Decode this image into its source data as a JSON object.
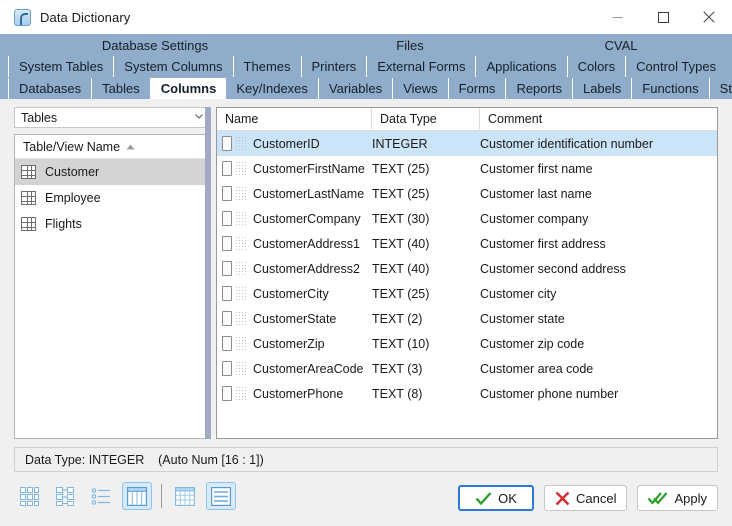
{
  "window": {
    "title": "Data Dictionary",
    "app_icon": "app-icon",
    "controls": {
      "minimize": "─",
      "maximize": "□",
      "close": "✕"
    }
  },
  "tab_groups": [
    {
      "label": "Database Settings"
    },
    {
      "label": "Files"
    },
    {
      "label": "CVAL"
    }
  ],
  "tabs_row1": [
    {
      "label": "System Tables",
      "selected": false
    },
    {
      "label": "System Columns",
      "selected": false
    },
    {
      "label": "Themes",
      "selected": false
    },
    {
      "label": "Printers",
      "selected": false
    },
    {
      "label": "External Forms",
      "selected": false
    },
    {
      "label": "Applications",
      "selected": false
    },
    {
      "label": "Colors",
      "selected": false
    },
    {
      "label": "Control Types",
      "selected": false
    }
  ],
  "tabs_row2": [
    {
      "label": "Databases",
      "selected": false
    },
    {
      "label": "Tables",
      "selected": false
    },
    {
      "label": "Columns",
      "selected": true
    },
    {
      "label": "Key/Indexes",
      "selected": false
    },
    {
      "label": "Variables",
      "selected": false
    },
    {
      "label": "Views",
      "selected": false
    },
    {
      "label": "Forms",
      "selected": false
    },
    {
      "label": "Reports",
      "selected": false
    },
    {
      "label": "Labels",
      "selected": false
    },
    {
      "label": "Functions",
      "selected": false
    },
    {
      "label": "Stored Procedures",
      "selected": false
    }
  ],
  "left_panel": {
    "combo": {
      "value": "Tables",
      "options": [
        "Tables"
      ]
    },
    "list_header": "Table/View Name",
    "sort_direction": "ascending",
    "items": [
      {
        "label": "Customer",
        "selected": true
      },
      {
        "label": "Employee",
        "selected": false
      },
      {
        "label": "Flights",
        "selected": false
      }
    ]
  },
  "grid": {
    "columns": [
      "Name",
      "Data Type",
      "Comment"
    ],
    "rows": [
      {
        "name": "CustomerID",
        "type": "INTEGER",
        "comment": "Customer identification number",
        "selected": true
      },
      {
        "name": "CustomerFirstName",
        "type": "TEXT (25)",
        "comment": "Customer first name",
        "selected": false
      },
      {
        "name": "CustomerLastName",
        "type": "TEXT (25)",
        "comment": "Customer last name",
        "selected": false
      },
      {
        "name": "CustomerCompany",
        "type": "TEXT (30)",
        "comment": "Customer company",
        "selected": false
      },
      {
        "name": "CustomerAddress1",
        "type": "TEXT (40)",
        "comment": "Customer first address",
        "selected": false
      },
      {
        "name": "CustomerAddress2",
        "type": "TEXT (40)",
        "comment": "Customer second address",
        "selected": false
      },
      {
        "name": "CustomerCity",
        "type": "TEXT (25)",
        "comment": "Customer city",
        "selected": false
      },
      {
        "name": "CustomerState",
        "type": "TEXT (2)",
        "comment": "Customer state",
        "selected": false
      },
      {
        "name": "CustomerZip",
        "type": "TEXT (10)",
        "comment": "Customer zip code",
        "selected": false
      },
      {
        "name": "CustomerAreaCode",
        "type": "TEXT (3)",
        "comment": "Customer area code",
        "selected": false
      },
      {
        "name": "CustomerPhone",
        "type": "TEXT (8)",
        "comment": "Customer phone number",
        "selected": false
      }
    ]
  },
  "status_bar": {
    "text": "Data Type: INTEGER    (Auto Num [16 : 1])"
  },
  "view_buttons": [
    {
      "name": "large-icons-view",
      "active": false
    },
    {
      "name": "tree-view",
      "active": false
    },
    {
      "name": "list-view",
      "active": false
    },
    {
      "name": "column-view",
      "active": true
    },
    {
      "name": "grid-view",
      "active": false
    },
    {
      "name": "detail-view",
      "active": true
    }
  ],
  "dialog_buttons": [
    {
      "label": "OK",
      "icon": "check-icon",
      "default": true
    },
    {
      "label": "Cancel",
      "icon": "cross-icon",
      "default": false
    },
    {
      "label": "Apply",
      "icon": "double-check-icon",
      "default": false
    }
  ],
  "colors": {
    "tab_band": "#8facca",
    "selection_row": "#cce4f7",
    "list_selection": "#d4d4d4",
    "splitter": "#9fabc4",
    "accent_blue": "#2c7ad6",
    "ok_green": "#2aa02a",
    "cancel_red": "#d12b2b",
    "window_bg": "#f0f0f0"
  }
}
